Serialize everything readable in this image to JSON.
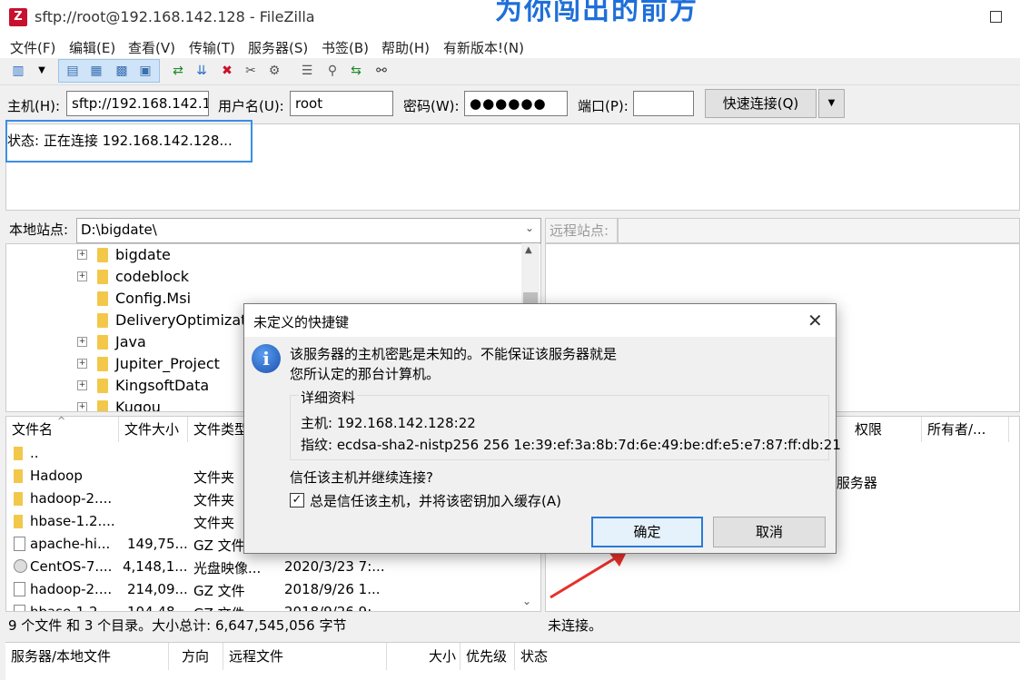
{
  "window": {
    "app_icon": "Z",
    "title": "sftp://root@192.168.142.128 - FileZilla",
    "overlay_text": "为你闯出的前方"
  },
  "menu": {
    "items": [
      "文件(F)",
      "编辑(E)",
      "查看(V)",
      "传输(T)",
      "服务器(S)",
      "书签(B)",
      "帮助(H)",
      "有新版本!(N)"
    ]
  },
  "quickconnect": {
    "host_label": "主机(H):",
    "host_value": "sftp://192.168.142.1",
    "user_label": "用户名(U):",
    "user_value": "root",
    "pass_label": "密码(W):",
    "pass_value": "●●●●●●",
    "port_label": "端口(P):",
    "port_value": "",
    "connect_button": "快速连接(Q)",
    "dropdown_arrow": "▼"
  },
  "log": {
    "status_line": "状态: 正在连接 192.168.142.128..."
  },
  "local": {
    "label": "本地站点:",
    "path": "D:\\bigdate\\",
    "tree": [
      {
        "name": "bigdate",
        "expandable": true
      },
      {
        "name": "codeblock",
        "expandable": true
      },
      {
        "name": "Config.Msi",
        "expandable": false
      },
      {
        "name": "DeliveryOptimizatio",
        "expandable": false
      },
      {
        "name": "Java",
        "expandable": true
      },
      {
        "name": "Jupiter_Project",
        "expandable": true
      },
      {
        "name": "KingsoftData",
        "expandable": true
      },
      {
        "name": "Kugou",
        "expandable": true
      }
    ],
    "list_headers": [
      "文件名",
      "文件大小",
      "文件类型"
    ],
    "files": [
      {
        "name": "..",
        "size": "",
        "type": "",
        "date": "",
        "icon": "folder"
      },
      {
        "name": "Hadoop",
        "size": "",
        "type": "文件夹",
        "date": "",
        "icon": "folder"
      },
      {
        "name": "hadoop-2....",
        "size": "",
        "type": "文件夹",
        "date": "",
        "icon": "folder"
      },
      {
        "name": "hbase-1.2....",
        "size": "",
        "type": "文件夹",
        "date": "",
        "icon": "folder"
      },
      {
        "name": "apache-hi...",
        "size": "149,75...",
        "type": "GZ 文件",
        "date": "",
        "icon": "file"
      },
      {
        "name": "CentOS-7....",
        "size": "4,148,1...",
        "type": "光盘映像...",
        "date": "2020/3/23 7:...",
        "icon": "disc"
      },
      {
        "name": "hadoop-2....",
        "size": "214,09...",
        "type": "GZ 文件",
        "date": "2018/9/26 1...",
        "icon": "file"
      },
      {
        "name": "hbase-1.2....",
        "size": "104,48...",
        "type": "GZ 文件",
        "date": "2018/9/26 9:...",
        "icon": "file"
      }
    ],
    "status": "9 个文件 和 3 个目录。大小总计: 6,647,545,056 字节"
  },
  "remote": {
    "label": "远程站点:",
    "list_headers": [
      "权限",
      "所有者/..."
    ],
    "partial_text": "]服务器",
    "status": "未连接。"
  },
  "queue": {
    "headers": [
      "服务器/本地文件",
      "方向",
      "远程文件",
      "大小",
      "优先级",
      "状态"
    ]
  },
  "dialog": {
    "title": "未定义的快捷键",
    "close": "✕",
    "info_icon": "i",
    "message_line1": "该服务器的主机密匙是未知的。不能保证该服务器就是",
    "message_line2": "您所认定的那台计算机。",
    "details_title": "详细资料",
    "host": "主机: 192.168.142.128:22",
    "fingerprint": "指纹: ecdsa-sha2-nistp256 256 1e:39:ef:3a:8b:7d:6e:49:be:df:e5:e7:87:ff:db:21",
    "question": "信任该主机并继续连接?",
    "checkbox_mark": "✓",
    "checkbox_label": "总是信任该主机，并将该密钥加入缓存(A)",
    "ok_button": "确定",
    "cancel_button": "取消"
  },
  "colors": {
    "accent": "#2a7ad6",
    "annotation_red": "#e8302a",
    "folder": "#f2c84b"
  }
}
